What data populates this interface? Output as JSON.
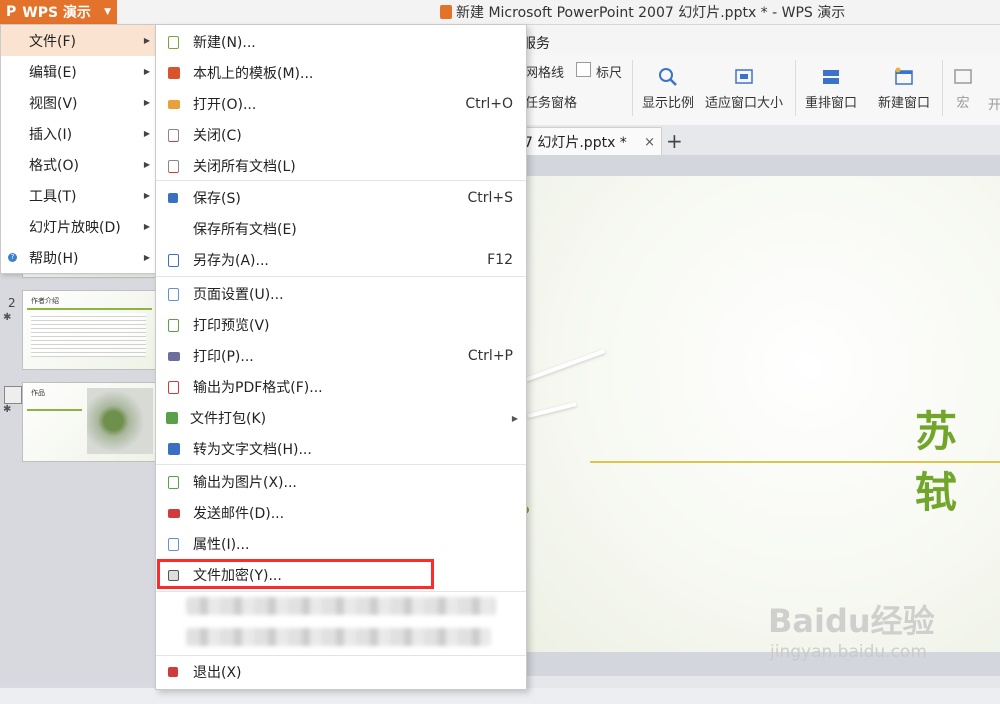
{
  "app": {
    "logo": "P",
    "name": "WPS 演示"
  },
  "window_title": "新建 Microsoft PowerPoint 2007 幻灯片.pptx * - WPS 演示",
  "menubar_visible": "服务",
  "toolbar": {
    "checks": [
      "网格线",
      "标尺"
    ],
    "task_pane": "任务窗格",
    "buttons": [
      "显示比例",
      "适应窗口大小",
      "重排窗口",
      "新建窗口",
      "宏",
      "开"
    ]
  },
  "doc_tab": {
    "title": "7 幻灯片.pptx *",
    "close": "×",
    "new": "+"
  },
  "thumbnails": [
    {
      "num": "2",
      "title": "作者介绍"
    },
    {
      "num": "",
      "title": "作品"
    }
  ],
  "slide": {
    "title_partial": "苏轼"
  },
  "main_menu": [
    {
      "label": "文件(F)",
      "active": true
    },
    {
      "label": "编辑(E)"
    },
    {
      "label": "视图(V)"
    },
    {
      "label": "插入(I)"
    },
    {
      "label": "格式(O)"
    },
    {
      "label": "工具(T)"
    },
    {
      "label": "幻灯片放映(D)"
    },
    {
      "label": "帮助(H)"
    }
  ],
  "file_menu": [
    {
      "label": "新建(N)...",
      "shortcut": "",
      "icon": "new-icon",
      "color": "#7aa33c"
    },
    {
      "label": "本机上的模板(M)...",
      "shortcut": "",
      "icon": "template-icon",
      "color": "#d9532c"
    },
    {
      "label": "打开(O)...",
      "shortcut": "Ctrl+O",
      "icon": "open-folder-icon",
      "color": "#e8a13a"
    },
    {
      "label": "关闭(C)",
      "shortcut": "",
      "icon": "close-doc-icon",
      "color": "#d03a3a"
    },
    {
      "label": "关闭所有文档(L)",
      "shortcut": "",
      "icon": "close-all-icon",
      "color": "#d03a3a"
    },
    {
      "label": "保存(S)",
      "shortcut": "Ctrl+S",
      "icon": "save-icon",
      "color": "#3b6fc4"
    },
    {
      "label": "保存所有文档(E)",
      "shortcut": "",
      "icon": "",
      "color": ""
    },
    {
      "label": "另存为(A)...",
      "shortcut": "F12",
      "icon": "save-as-icon",
      "color": "#3b6fc4"
    },
    {
      "label": "页面设置(U)...",
      "shortcut": "",
      "icon": "page-setup-icon",
      "color": "#6a8fcf"
    },
    {
      "label": "打印预览(V)",
      "shortcut": "",
      "icon": "print-preview-icon",
      "color": "#5aa048"
    },
    {
      "label": "打印(P)...",
      "shortcut": "Ctrl+P",
      "icon": "print-icon",
      "color": "#6d6d9e"
    },
    {
      "label": "输出为PDF格式(F)...",
      "shortcut": "",
      "icon": "pdf-icon",
      "color": "#d03a3a"
    },
    {
      "label": "文件打包(K)",
      "shortcut": "",
      "icon": "package-icon",
      "color": "#5aa048",
      "submenu": true
    },
    {
      "label": "转为文字文档(H)...",
      "shortcut": "",
      "icon": "convert-icon",
      "color": "#3b6fc4"
    },
    {
      "label": "输出为图片(X)...",
      "shortcut": "",
      "icon": "export-image-icon",
      "color": "#5aa048"
    },
    {
      "label": "发送邮件(D)...",
      "shortcut": "",
      "icon": "mail-icon",
      "color": "#d03a3a"
    },
    {
      "label": "属性(I)...",
      "shortcut": "",
      "icon": "properties-icon",
      "color": "#6a8fcf"
    },
    {
      "label": "文件加密(Y)...",
      "shortcut": "",
      "icon": "encrypt-icon",
      "color": "#555555"
    },
    {
      "label": "退出(X)",
      "shortcut": "",
      "icon": "exit-icon",
      "color": "#d03a3a"
    }
  ],
  "watermark": {
    "main": "Baidu经验",
    "sub": "jingyan.baidu.com"
  }
}
